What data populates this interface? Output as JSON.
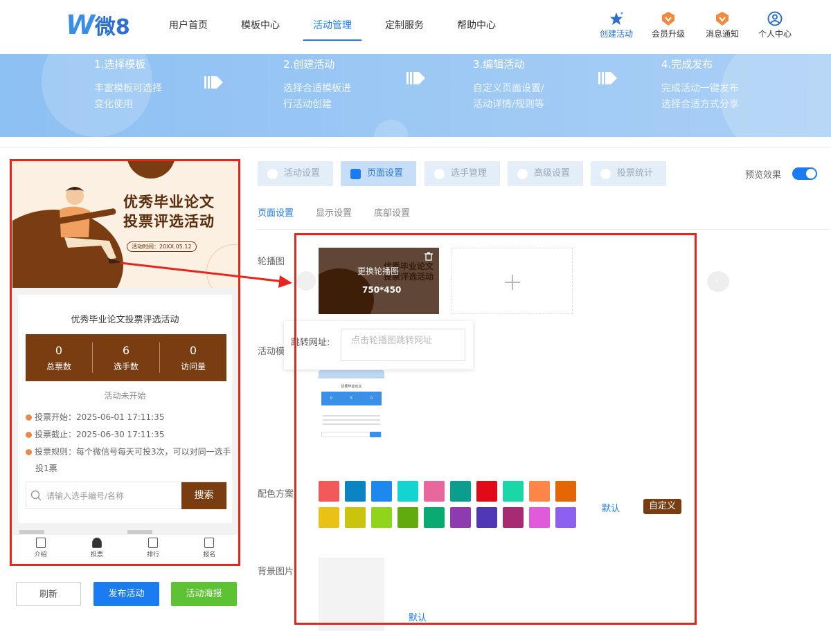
{
  "header": {
    "logo": {
      "w": "W",
      "text": "微8"
    },
    "nav": [
      "用户首页",
      "模板中心",
      "活动管理",
      "定制服务",
      "帮助中心"
    ],
    "actions": [
      {
        "label": "创建活动",
        "icon": "star-icon"
      },
      {
        "label": "会员升级",
        "icon": "vip-icon"
      },
      {
        "label": "消息通知",
        "icon": "bell-icon"
      },
      {
        "label": "个人中心",
        "icon": "user-icon"
      }
    ]
  },
  "banner": {
    "steps": [
      {
        "title": "1.选择模板",
        "line1": "丰富模板可选择",
        "line2": "变化使用"
      },
      {
        "title": "2.创建活动",
        "line1": "选择合适模板进",
        "line2": "行活动创建"
      },
      {
        "title": "3.编辑活动",
        "line1": "自定义页面设置/",
        "line2": "活动详情/规则等"
      },
      {
        "title": "4.完成发布",
        "line1": "完成活动一键发布",
        "line2": "选择合适方式分享"
      }
    ]
  },
  "phone": {
    "hero_title1": "优秀毕业论文",
    "hero_title2": "投票评选活动",
    "hero_time": "活动时间：20XX.05.12",
    "activity_title": "优秀毕业论文投票评选活动",
    "stats": [
      {
        "value": "0",
        "label": "总票数"
      },
      {
        "value": "6",
        "label": "选手数"
      },
      {
        "value": "0",
        "label": "访问量"
      }
    ],
    "status": "活动未开始",
    "vote_start": "投票开始：2025-06-01 17:11:35",
    "vote_end": "投票截止：2025-06-30 17:11:35",
    "vote_rule_1": "投票规则：每个微信号每天可投3次，可以对同一选手",
    "vote_rule_2": "投1票",
    "search_placeholder": "请输入选手编号/名称",
    "search_button": "搜索",
    "tabbar": [
      "介绍",
      "投票",
      "排行",
      "报名"
    ]
  },
  "buttons": {
    "refresh": "刷新",
    "publish": "发布活动",
    "poster": "活动海报"
  },
  "panel": {
    "tabs": [
      "活动设置",
      "页面设置",
      "选手管理",
      "高级设置",
      "投票统计"
    ],
    "preview_label": "预览效果",
    "preview_on": true,
    "subtabs": [
      "页面设置",
      "显示设置",
      "底部设置"
    ],
    "carousel_label": "轮播图",
    "carousel_replace": "更换轮播图",
    "carousel_size": "750*450",
    "jump_label": "跳转网址:",
    "jump_placeholder": "点击轮播图跳转网址",
    "template_label": "活动模",
    "color_label": "配色方案",
    "color_default": "默认",
    "color_custom": "自定义",
    "bg_label": "背景图片",
    "bg_default": "默认",
    "colors": [
      "#f25a5a",
      "#0b84c4",
      "#1e88ee",
      "#13d4d0",
      "#e8679d",
      "#0b9e8e",
      "#e10b17",
      "#1bd6a6",
      "#fe8548",
      "#e56605",
      "#eac215",
      "#cbc40d",
      "#8fd51b",
      "#62ab0f",
      "#0aaa73",
      "#8e3bb0",
      "#5038b4",
      "#a72b73",
      "#e05bdc",
      "#8f5ff0"
    ]
  },
  "mini": {
    "title": "优秀毕业论文",
    "stats": [
      "0",
      "6",
      "0"
    ]
  }
}
